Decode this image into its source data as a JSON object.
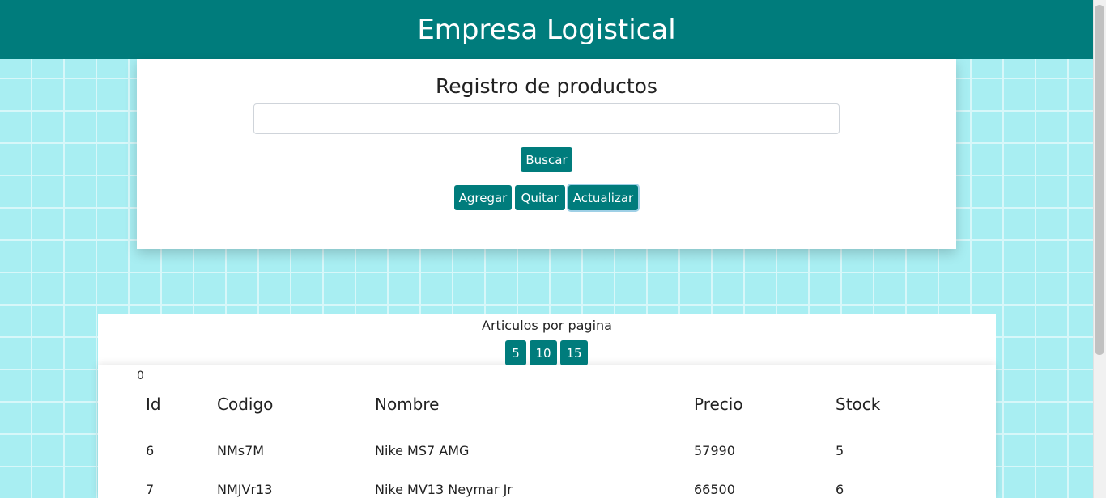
{
  "header": {
    "title": "Empresa Logistical"
  },
  "form": {
    "title": "Registro de productos",
    "search_value": "",
    "search_placeholder": "",
    "buscar_label": "Buscar",
    "agregar_label": "Agregar",
    "quitar_label": "Quitar",
    "actualizar_label": "Actualizar"
  },
  "pagination": {
    "label": "Articulos por pagina",
    "options": [
      "5",
      "10",
      "15"
    ],
    "count": "0"
  },
  "table": {
    "columns": [
      "Id",
      "Codigo",
      "Nombre",
      "Precio",
      "Stock"
    ],
    "rows": [
      [
        "6",
        "NMs7M",
        "Nike MS7 AMG",
        "57990",
        "5"
      ],
      [
        "7",
        "NMJVr13",
        "Nike MV13 Neymar Jr",
        "66500",
        "6"
      ]
    ]
  },
  "colors": {
    "brand": "#007c7c",
    "pattern": "#a8eef2"
  }
}
